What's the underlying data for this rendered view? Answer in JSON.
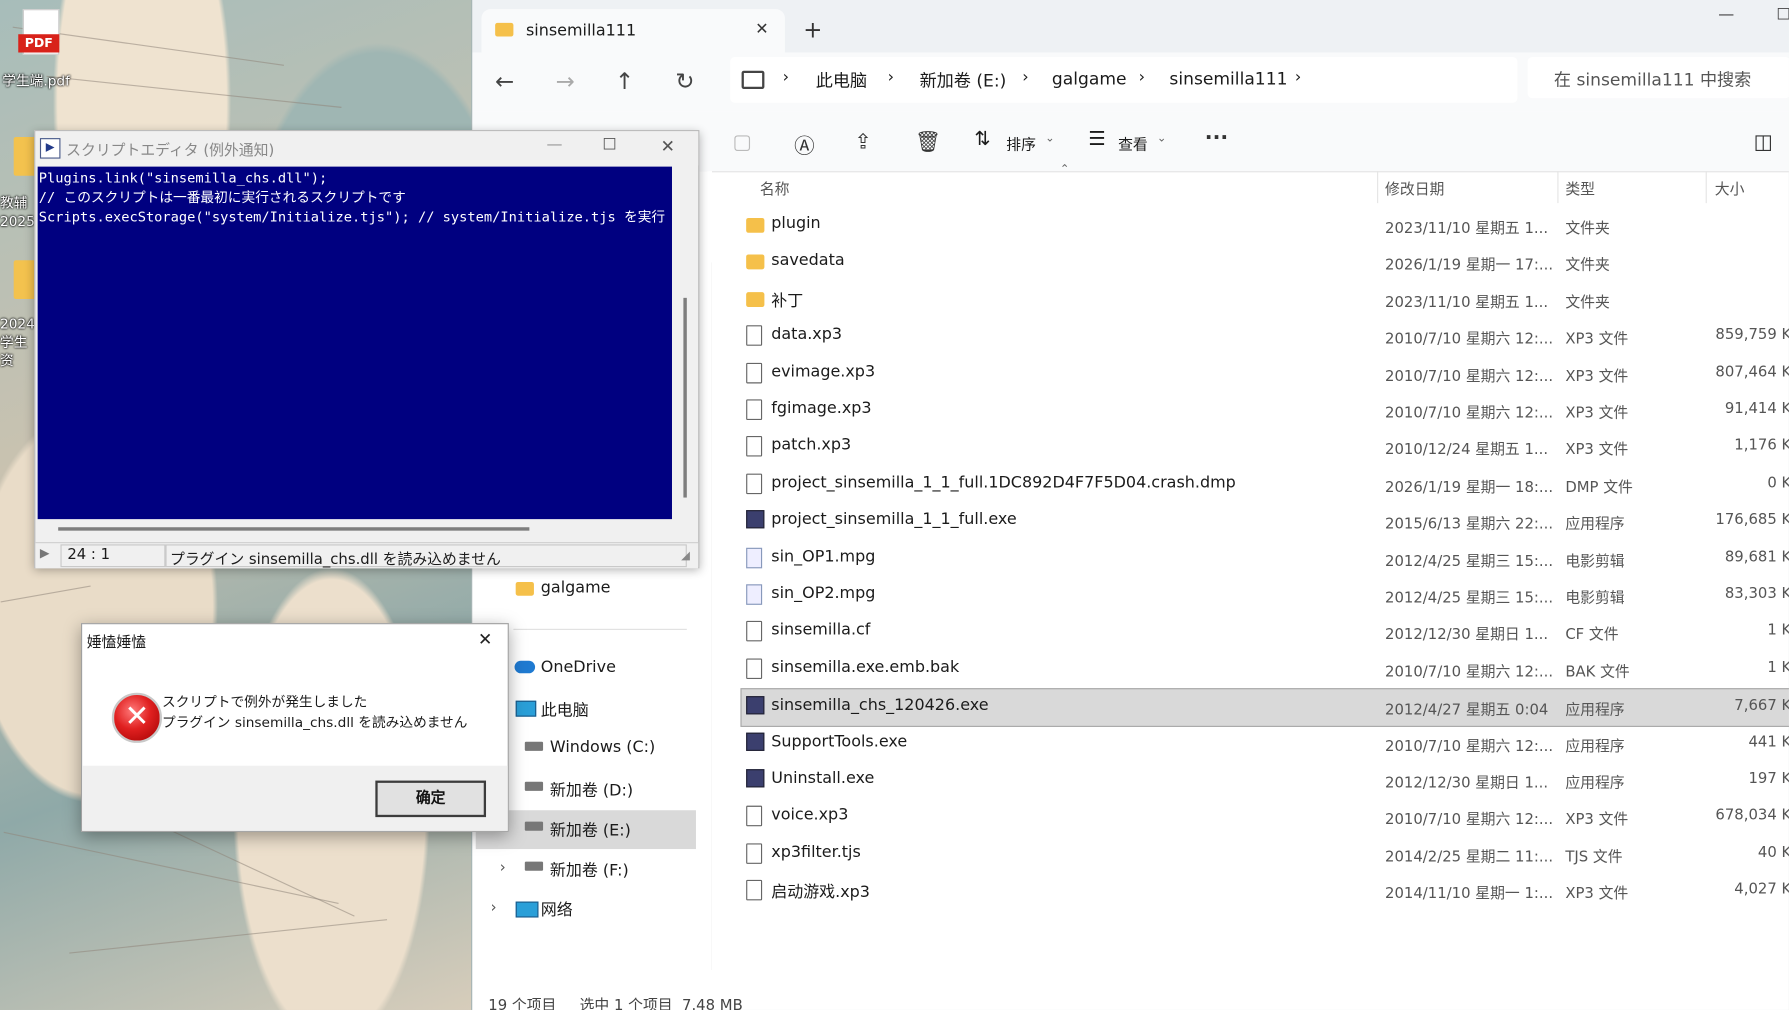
{
  "desktop": {
    "icons": [
      {
        "label": "学生端.pdf",
        "badge": "PDF"
      },
      {
        "label": "教辅 2025"
      },
      {
        "label": "2024 学生资"
      }
    ]
  },
  "explorer": {
    "tab_title": "sinsemilla111",
    "tab_close": "✕",
    "new_tab": "+",
    "window_controls": [
      "—",
      "☐"
    ],
    "nav": {
      "back": "←",
      "forward": "→",
      "up": "↑",
      "refresh": "↻"
    },
    "breadcrumb": [
      "此电脑",
      "新加卷 (E:)",
      "galgame",
      "sinsemilla111"
    ],
    "search_placeholder": "在 sinsemilla111 中搜索",
    "toolbar": {
      "sort": "排序",
      "view": "查看",
      "more": "···"
    },
    "columns": {
      "name": "名称",
      "modified": "修改日期",
      "type": "类型",
      "size": "大小"
    },
    "files": [
      {
        "name": "plugin",
        "modified": "2023/11/10 星期五 1...",
        "type": "文件夹",
        "size": "",
        "icon": "folder-icon",
        "selected": false
      },
      {
        "name": "savedata",
        "modified": "2026/1/19 星期一 17:...",
        "type": "文件夹",
        "size": "",
        "icon": "folder-icon",
        "selected": false
      },
      {
        "name": "补丁",
        "modified": "2023/11/10 星期五 1...",
        "type": "文件夹",
        "size": "",
        "icon": "folder-icon",
        "selected": false
      },
      {
        "name": "data.xp3",
        "modified": "2010/7/10 星期六 12:...",
        "type": "XP3 文件",
        "size": "859,759 K",
        "icon": "file-icon",
        "selected": false
      },
      {
        "name": "evimage.xp3",
        "modified": "2010/7/10 星期六 12:...",
        "type": "XP3 文件",
        "size": "807,464 K",
        "icon": "file-icon",
        "selected": false
      },
      {
        "name": "fgimage.xp3",
        "modified": "2010/7/10 星期六 12:...",
        "type": "XP3 文件",
        "size": "91,414 K",
        "icon": "file-icon",
        "selected": false
      },
      {
        "name": "patch.xp3",
        "modified": "2010/12/24 星期五 1...",
        "type": "XP3 文件",
        "size": "1,176 K",
        "icon": "file-icon",
        "selected": false
      },
      {
        "name": "project_sinsemilla_1_1_full.1DC892D4F7F5D04.crash.dmp",
        "modified": "2026/1/19 星期一 18:...",
        "type": "DMP 文件",
        "size": "0 K",
        "icon": "file-icon",
        "selected": false
      },
      {
        "name": "project_sinsemilla_1_1_full.exe",
        "modified": "2015/6/13 星期六 22:...",
        "type": "应用程序",
        "size": "176,685 K",
        "icon": "app-icon",
        "selected": false
      },
      {
        "name": "sin_OP1.mpg",
        "modified": "2012/4/25 星期三 15:...",
        "type": "电影剪辑",
        "size": "89,681 K",
        "icon": "video-icon",
        "selected": false
      },
      {
        "name": "sin_OP2.mpg",
        "modified": "2012/4/25 星期三 15:...",
        "type": "电影剪辑",
        "size": "83,303 K",
        "icon": "video-icon",
        "selected": false
      },
      {
        "name": "sinsemilla.cf",
        "modified": "2012/12/30 星期日 1...",
        "type": "CF 文件",
        "size": "1 K",
        "icon": "file-icon",
        "selected": false
      },
      {
        "name": "sinsemilla.exe.emb.bak",
        "modified": "2010/7/10 星期六 12:...",
        "type": "BAK 文件",
        "size": "1 K",
        "icon": "file-icon",
        "selected": false
      },
      {
        "name": "sinsemilla_chs_120426.exe",
        "modified": "2012/4/27 星期五 0:04",
        "type": "应用程序",
        "size": "7,667 K",
        "icon": "app-icon",
        "selected": true
      },
      {
        "name": "SupportTools.exe",
        "modified": "2010/7/10 星期六 12:...",
        "type": "应用程序",
        "size": "441 K",
        "icon": "app-icon",
        "selected": false
      },
      {
        "name": "Uninstall.exe",
        "modified": "2012/12/30 星期日 1...",
        "type": "应用程序",
        "size": "197 K",
        "icon": "app-icon",
        "selected": false
      },
      {
        "name": "voice.xp3",
        "modified": "2010/7/10 星期六 12:...",
        "type": "XP3 文件",
        "size": "678,034 K",
        "icon": "file-icon",
        "selected": false
      },
      {
        "name": "xp3filter.tjs",
        "modified": "2014/2/25 星期二 11:...",
        "type": "TJS 文件",
        "size": "40 K",
        "icon": "file-icon",
        "selected": false
      },
      {
        "name": "启动游戏.xp3",
        "modified": "2014/11/10 星期一 1:...",
        "type": "XP3 文件",
        "size": "4,027 K",
        "icon": "file-icon",
        "selected": false
      }
    ],
    "nav_pane": {
      "galgame": "galgame",
      "onedrive": "OneDrive",
      "this_pc": "此电脑",
      "drive_c": "Windows (C:)",
      "drive_d": "新加卷 (D:)",
      "drive_e": "新加卷 (E:)",
      "drive_f": "新加卷 (F:)",
      "network": "网络"
    },
    "status": {
      "item_count": "19 个项目",
      "selection": "选中 1 个项目  7.48 MB"
    }
  },
  "script_editor": {
    "title": "スクリプトエディタ (例外通知)",
    "lines": [
      "Plugins.link(\"sinsemilla_chs.dll\");",
      "// このスクリプトは一番最初に実行されるスクリプトです",
      "Scripts.execStorage(\"system/Initialize.tjs\"); // system/Initialize.tjs を実行"
    ],
    "status_position": "24 : 1",
    "status_message": "プラグイン sinsemilla_chs.dll を読み込めません"
  },
  "alert": {
    "title": "娷㥺娷㥺",
    "message_line1": "スクリプトで例外が発生しました",
    "message_line2": "プラグイン sinsemilla_chs.dll を読み込めません",
    "ok": "确定",
    "close": "✕"
  },
  "colors": {
    "editor_bg": "#000080",
    "selection": "#d9d9d9",
    "folder": "#f5c04a",
    "error": "#e02020"
  }
}
